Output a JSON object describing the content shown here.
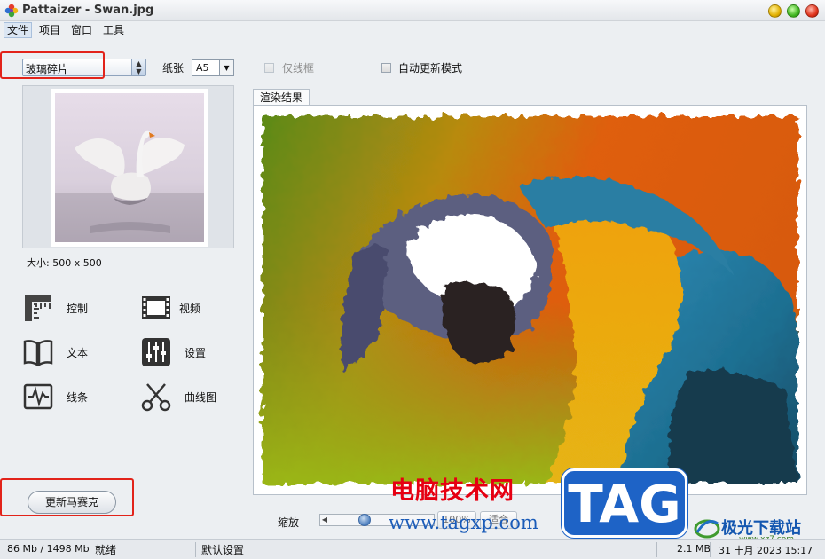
{
  "window": {
    "title": "Pattaizer - Swan.jpg"
  },
  "menubar": {
    "items": [
      "文件",
      "项目",
      "窗口",
      "工具"
    ]
  },
  "toolbar": {
    "mode_value": "玻璃碎片",
    "paper_label": "纸张",
    "paper_value": "A5",
    "frame_only_label": "仅线框",
    "auto_update_label": "自动更新模式"
  },
  "preview": {
    "size_text": "大小: 500 x 500"
  },
  "tools": {
    "control": "控制",
    "video": "视频",
    "text": "文本",
    "settings": "设置",
    "lines": "线条",
    "curves": "曲线图"
  },
  "actions": {
    "update_mosaic": "更新马赛克"
  },
  "render": {
    "tab_label": "渲染结果"
  },
  "zoom": {
    "label": "缩放",
    "percent_text": "100%",
    "fit_text": "适合"
  },
  "statusbar": {
    "memory": "86 Mb / 1498 Mb",
    "state": "就绪",
    "settings": "默认设置",
    "file_size": "2.1 MB",
    "datetime": "31 十月 2023   15:17"
  },
  "watermark": {
    "site_name": "电脑技术网",
    "site_url": "www.tagxp.com",
    "badge": "TAG",
    "jg_name": "极光下载站",
    "jg_url": "www.xz7.com"
  },
  "colors": {
    "highlight_box": "#e2231a",
    "badge_blue": "#1e63c6",
    "watermark_red": "#e60012"
  }
}
